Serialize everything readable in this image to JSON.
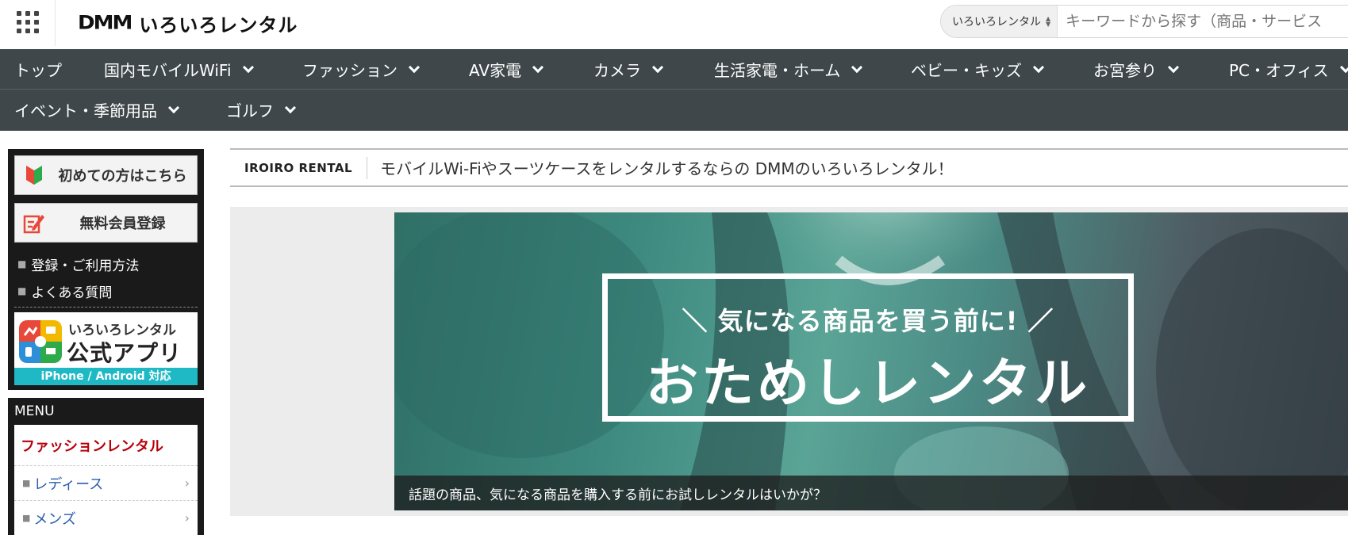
{
  "header": {
    "logo_brand": "DMM",
    "logo_service": "いろいろレンタル",
    "search_scope": "いろいろレンタル",
    "search_placeholder": "キーワードから探す（商品・サービス"
  },
  "nav": {
    "row1": [
      "トップ",
      "国内モバイルWiFi",
      "ファッション",
      "AV家電",
      "カメラ",
      "生活家電・ホーム",
      "ベビー・キッズ",
      "お宮参り",
      "PC・オフィス"
    ],
    "row2": [
      "イベント・季節用品",
      "ゴルフ"
    ]
  },
  "sidebar": {
    "first_time_label": "初めての方はこちら",
    "register_label": "無料会員登録",
    "links": [
      "登録・ご利用方法",
      "よくある質問"
    ],
    "app": {
      "title": "いろいろレンタル",
      "name": "公式アプリ",
      "platforms": "iPhone / Android 対応"
    },
    "menu_heading": "MENU",
    "menu_category": "ファッションレンタル",
    "menu_items": [
      "レディース",
      "メンズ"
    ]
  },
  "main": {
    "tag": "IROIRO RENTAL",
    "headline": "モバイルWi-Fiやスーツケースをレンタルするならの DMMのいろいろレンタル！",
    "banner": {
      "subtitle": "＼ 気になる商品を買う前に! ／",
      "title": "おためしレンタル",
      "caption": "話題の商品、気になる商品を購入する前にお試しレンタルはいかが？"
    }
  },
  "colors": {
    "nav_bg": "#3f474a",
    "accent_red": "#b8000a",
    "link_blue": "#2a5db0",
    "app_strip": "#1fb9c6"
  }
}
